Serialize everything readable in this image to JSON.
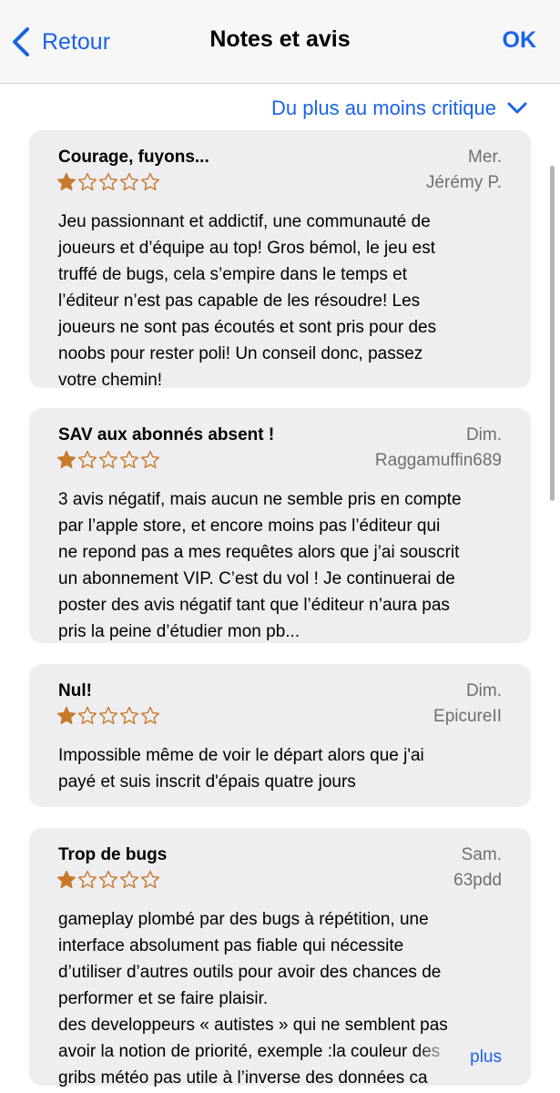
{
  "nav": {
    "back_label": "Retour",
    "title": "Notes et avis",
    "ok_label": "OK"
  },
  "sort": {
    "label": "Du plus au moins critique"
  },
  "colors": {
    "accent": "#1a63e6",
    "star": "#c87a2c",
    "card_bg": "#eeeef1"
  },
  "reviews": [
    {
      "title": "Courage, fuyons...",
      "date": "Mer.",
      "author": "Jérémy P.",
      "rating": 1,
      "body": "Jeu passionnant et addictif, une communauté de\njoueurs et d’équipe au top! Gros bémol, le jeu est\ntruffé de bugs, cela s’empire dans le temps et\nl’éditeur n’est pas capable de les résoudre! Les\njoueurs ne sont pas écoutés et sont pris pour des\nnoobs pour rester poli! Un conseil donc, passez\nvotre chemin!"
    },
    {
      "title": "SAV aux abonnés absent !",
      "date": "Dim.",
      "author": "Raggamuffin689",
      "rating": 1,
      "body": "3 avis négatif, mais aucun ne semble pris en compte\npar l’apple store, et encore moins pas l’éditeur qui\nne repond pas a mes requêtes alors que j’ai souscrit\nun abonnement VIP. C’est du vol ! Je continuerai de\nposter des avis négatif tant que l’éditeur n’aura pas\npris la peine d’étudier mon pb..."
    },
    {
      "title": "Nul!",
      "date": "Dim.",
      "author": "EpicureII",
      "rating": 1,
      "body": "Impossible même de voir le départ alors que j'ai\npayé et suis inscrit d'épais quatre jours"
    },
    {
      "title": "Trop de bugs",
      "date": "Sam.",
      "author": "63pdd",
      "rating": 1,
      "body": "gameplay plombé par des bugs à répétition, une\ninterface absolument pas fiable qui nécessite\nd’utiliser d’autres outils pour avoir des chances de\nperformer et se faire plaisir.\ndes developpeurs « autistes » qui ne semblent pas\navoir la notion de priorité, exemple :la couleur des\ngribs météo pas utile à l’inverse des données ca",
      "more_label": "plus"
    }
  ]
}
